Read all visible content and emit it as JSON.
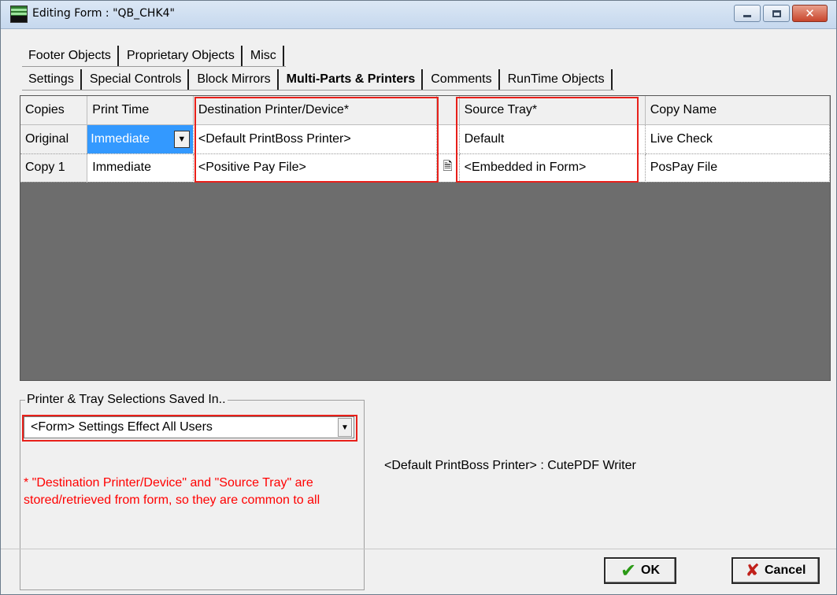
{
  "window": {
    "title": "Editing Form : \"QB_CHK4\""
  },
  "tabs_row1": [
    {
      "label": "Footer Objects",
      "underline": "F"
    },
    {
      "label": "Proprietary Objects"
    },
    {
      "label": "Misc"
    }
  ],
  "tabs_row2": [
    {
      "label": "Settings"
    },
    {
      "label": "Special Controls"
    },
    {
      "label": "Block Mirrors"
    },
    {
      "label": "Multi-Parts & Printers",
      "active": true
    },
    {
      "label": "Comments"
    },
    {
      "label": "RunTime Objects"
    }
  ],
  "grid": {
    "headers": [
      "Copies",
      "Print Time",
      "Destination Printer/Device*",
      "Source Tray*",
      "Copy Name"
    ],
    "rows": [
      {
        "copies": "Original",
        "print_time": "Immediate",
        "destination": "<Default PrintBoss Printer>",
        "source_tray": "Default",
        "copy_name": "Live Check"
      },
      {
        "copies": "Copy 1",
        "print_time": "Immediate",
        "destination": "<Positive Pay File>",
        "source_tray": "<Embedded in Form>",
        "copy_name": "PosPay File"
      }
    ]
  },
  "printer_tray": {
    "legend": "Printer & Tray Selections Saved In..",
    "selected": "<Form> Settings Effect All Users",
    "note": "* \"Destination Printer/Device\" and \"Source Tray\" are stored/retrieved from form, so they are common to all"
  },
  "printer_info": "<Default PrintBoss Printer> : CutePDF Writer",
  "buttons": {
    "ok": "OK",
    "cancel": "Cancel"
  },
  "colors": {
    "highlight": "#e8201a",
    "selection": "#3399ff",
    "note_text": "#ff0000"
  }
}
